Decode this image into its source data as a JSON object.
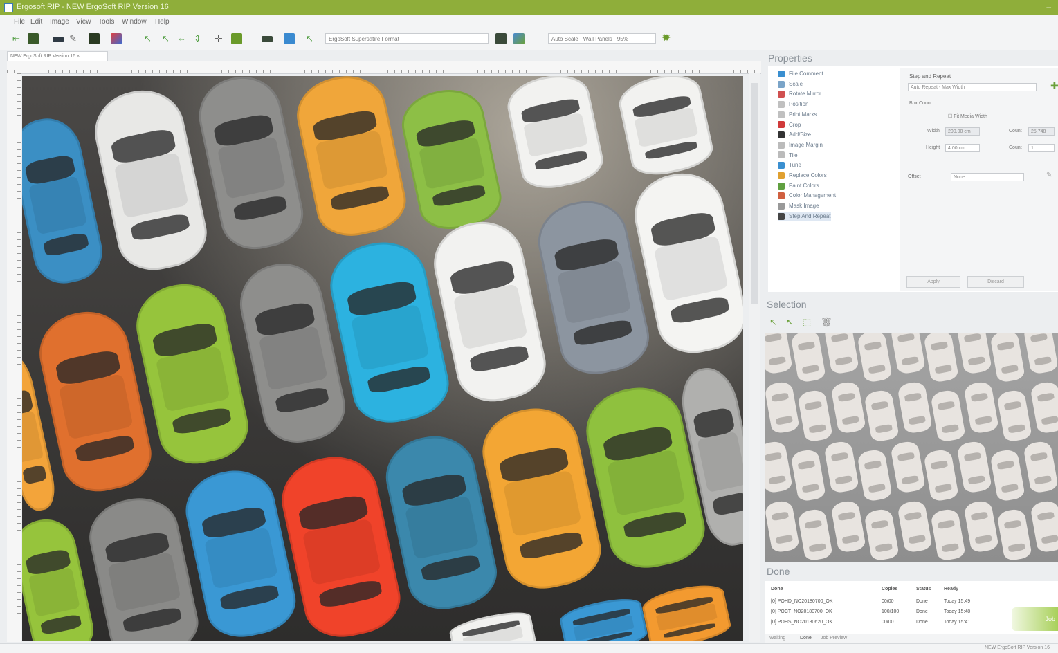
{
  "window": {
    "title": "Ergosoft RIP - NEW ErgoSoft RIP Version 16"
  },
  "menu": [
    "File",
    "Edit",
    "Image",
    "View",
    "Tools",
    "Window",
    "Help"
  ],
  "toolbar": {
    "media_select": "ErgoSoft Supersatire Format",
    "scale_select": "Auto Scale · Wall Panels · 95%"
  },
  "document_tab": "NEW ErgoSoft RIP Version 16",
  "properties": {
    "title": "Properties",
    "items": [
      {
        "label": "File Comment",
        "icon_color": "#3a8fd0"
      },
      {
        "label": "Scale",
        "icon_color": "#7aa4c8"
      },
      {
        "label": "Rotate Mirror",
        "icon_color": "#d05050"
      },
      {
        "label": "Position",
        "icon_color": "#c0c0c0"
      },
      {
        "label": "Print Marks",
        "icon_color": "#c0c0c0"
      },
      {
        "label": "Crop",
        "icon_color": "#d03a3a"
      },
      {
        "label": "Add/Size",
        "icon_color": "#333333"
      },
      {
        "label": "Image Margin",
        "icon_color": "#bbbbbb"
      },
      {
        "label": "Tile",
        "icon_color": "#bbbbbb"
      },
      {
        "label": "Tune",
        "icon_color": "#3a8fd0"
      },
      {
        "label": "Replace Colors",
        "icon_color": "#e0a030"
      },
      {
        "label": "Paint Colors",
        "icon_color": "#60a040"
      },
      {
        "label": "Color Management",
        "icon_color": "#d06040"
      },
      {
        "label": "Mask Image",
        "icon_color": "#999999"
      },
      {
        "label": "Step And Repeat",
        "icon_color": "#444444"
      }
    ],
    "form": {
      "section": "Step and Repeat",
      "mode_value": "Auto Repeat - Max Width",
      "box_count_label": "Box Count",
      "fit_media_label": "Fit Media Width",
      "width_label": "Width",
      "width_value": "200.00 cm",
      "height_label": "Height",
      "height_value": "4.00 cm",
      "count_label_1": "Count",
      "count_value_1": "25.748",
      "count_label_2": "Count",
      "count_value_2": "1",
      "offset_label": "Offset",
      "offset_value": "None",
      "apply_label": "Apply",
      "discard_label": "Discard"
    }
  },
  "selection": {
    "title": "Selection"
  },
  "done": {
    "title": "Done",
    "columns": [
      "Done",
      "Copies",
      "Status",
      "Ready"
    ],
    "rows": [
      [
        "[0] POHD_NO20180700_OK",
        "00/00",
        "Done",
        "Today 15:49"
      ],
      [
        "[0] POCT_NO20180700_OK",
        "100/100",
        "Done",
        "Today 15:48"
      ],
      [
        "[0] POHS_NO20180620_OK",
        "00/00",
        "Done",
        "Today 15:41"
      ]
    ],
    "action_label": "Job"
  },
  "bottom_tabs": [
    "Waiting",
    "Done",
    "Job Preview"
  ],
  "status": {
    "right_text": "NEW ErgoSoft RIP Version 16"
  }
}
